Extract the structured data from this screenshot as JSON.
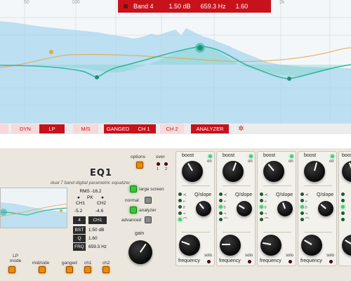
{
  "analyzer": {
    "freq_labels": [
      "50",
      "100",
      "2k"
    ],
    "banner": {
      "band": "Band 4",
      "gain": "1.50 dB",
      "freq": "659.3 Hz",
      "q": "1.60"
    },
    "colors": {
      "accent": "#c8121b",
      "curve": "#2fb8a0",
      "spectrum": "#a9d7ee",
      "orange": "#e0a848"
    }
  },
  "toolbar": {
    "dyn": "DYN",
    "lp": "LP",
    "ms": "M/S",
    "ganged": "GANGED",
    "ch1": "CH 1",
    "ch2": "CH 2",
    "analyzer": "ANALYZER",
    "settings_icon": "gear-icon"
  },
  "plugin": {
    "title": "EQ1",
    "subtitle": "dual 7 band digital parametric equalizer",
    "readout": {
      "rms": "RMS  -16.2",
      "pk": "PK",
      "ch1": "CH1",
      "ch2": "CH2",
      "val_left": "-5.2",
      "val_right": "-4.6",
      "band_num": "4",
      "ch_sel": "CH1",
      "bst_label": "BST",
      "bst_value": "1.50 dB",
      "q_label": "Q",
      "q_value": "1.60",
      "frq_label": "FRQ",
      "frq_value": "659.3 Hz"
    },
    "options": "options",
    "over": "over",
    "over_1": "1",
    "over_2": "2",
    "large_screen": "large screen",
    "normal": "normal",
    "analyzer": "analyzer",
    "advanced": "advanced",
    "gain": "gain",
    "bottom": {
      "lp_mode": "LP\nmode",
      "mid_side": "mid/side",
      "ganged": "ganged",
      "ch1": "ch1",
      "ch2": "ch2"
    },
    "band_labels": {
      "boost": "boost",
      "on": "on",
      "q_slope": "Q/slope",
      "frequency": "frequency",
      "solo": "solo"
    }
  }
}
